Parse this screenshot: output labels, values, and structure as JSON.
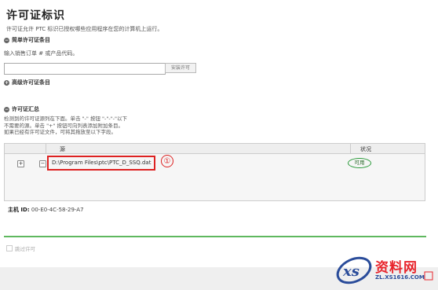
{
  "header": {
    "title": "许可证标识",
    "description": "许可证允许 PTC 标识已授权哪些应用程序在您的计算机上运行。"
  },
  "simple_license": {
    "label": "简单许可证条目",
    "prompt": "输入销售订单 # 或产品代码。",
    "input_value": "",
    "install_button": "安装许可"
  },
  "advanced_license": {
    "label": "高级许可证条目"
  },
  "summary": {
    "label": "许可证汇总",
    "lines": [
      "检测到的许可证源列在下面。单击 \"-\" 按钮 \"-\"-\"-\"以下",
      "不需要的源。单击 \"+\" 按钮可向列表添加附加条目。",
      "如果已经有许可证文件，可将其拖放至以下字段。"
    ]
  },
  "table": {
    "headers": {
      "source": "源",
      "status": "状况"
    },
    "rows": [
      {
        "path": "D:\\Program Files\\ptc\\PTC_D_SSQ.dat",
        "status": "可用"
      }
    ]
  },
  "annotation": {
    "marker": "①"
  },
  "host": {
    "label": "主机 ID:",
    "value": "00-E0-4C-58-29-A7"
  },
  "footer": {
    "checkbox_label": "跳过许可"
  },
  "watermark": {
    "text": "资料网",
    "url": "ZL.XS1616.COM",
    "logo": "xs"
  },
  "colors": {
    "highlight_red": "#dd2222",
    "status_green": "#2a9a3a",
    "progress_green": "#5fb85f"
  }
}
